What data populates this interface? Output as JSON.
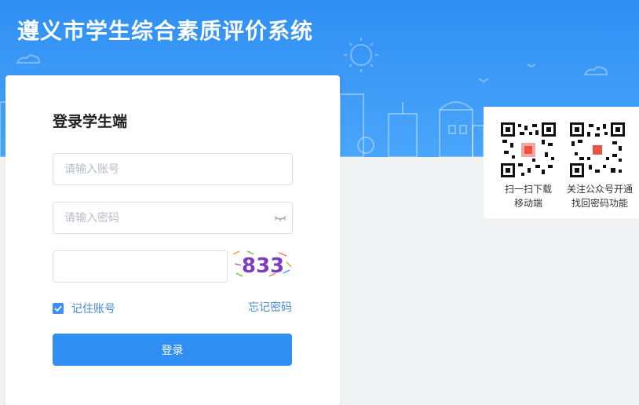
{
  "header": {
    "title": "遵义市学生综合素质评价系统"
  },
  "login": {
    "title": "登录学生端",
    "account_placeholder": "请输入账号",
    "password_placeholder": "请输入密码",
    "captcha_value": "",
    "captcha_text": "833",
    "remember_label": "记住账号",
    "remember_checked": true,
    "forgot_label": "忘记密码",
    "submit_label": "登录"
  },
  "qr_codes": [
    {
      "line1": "扫一扫下载",
      "line2": "移动端"
    },
    {
      "line1": "关注公众号开通",
      "line2": "找回密码功能"
    }
  ],
  "colors": {
    "primary": "#2f8ff3",
    "link": "#4a87d2",
    "background": "#f2f3f5"
  },
  "icons": {
    "password_toggle": "eye-closed-icon",
    "checkbox": "check-icon"
  }
}
